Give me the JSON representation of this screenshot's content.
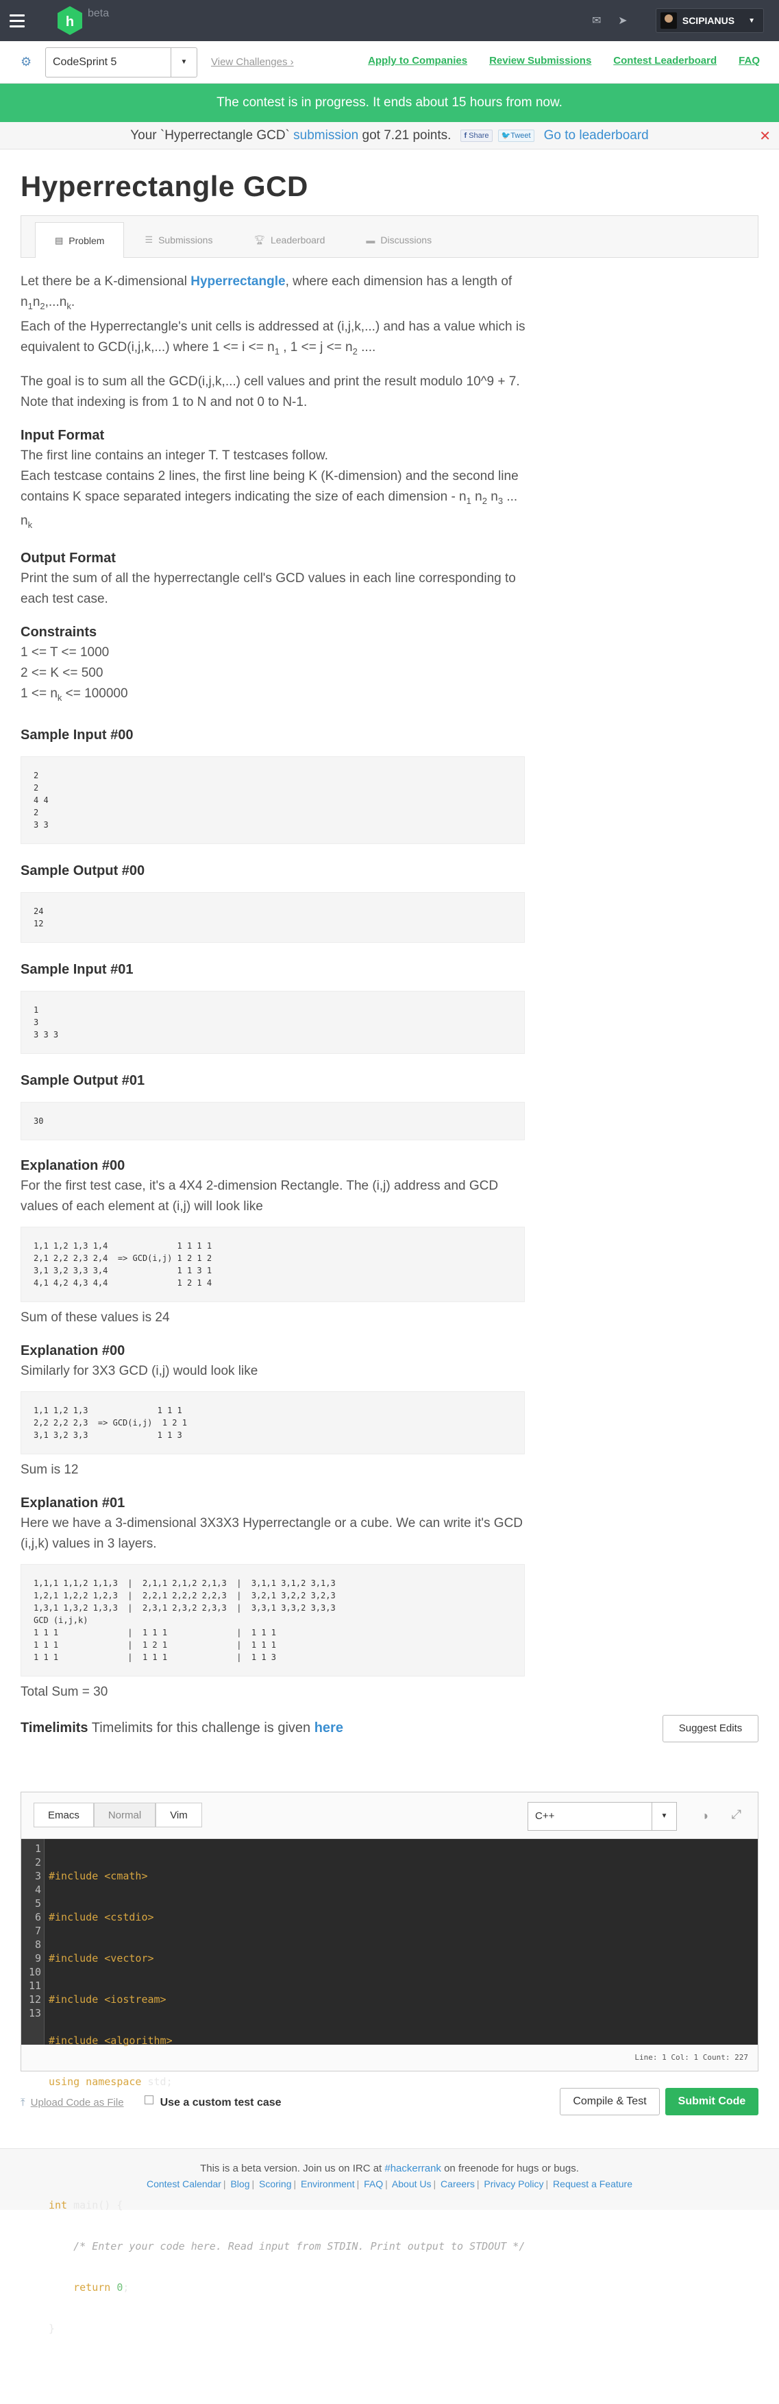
{
  "topnav": {
    "beta": "beta",
    "username": "SCIPIANUS"
  },
  "subnav": {
    "contest": "CodeSprint 5",
    "view_challenges": "View Challenges",
    "links": [
      "Apply to Companies",
      "Review Submissions",
      "Contest Leaderboard",
      "FAQ"
    ]
  },
  "banner": {
    "contest_status": "The contest is in progress. It ends about 15 hours from now.",
    "score_prefix": "Your `Hyperrectangle GCD`",
    "score_link": "submission",
    "score_suffix": "got 7.21 points.",
    "share": "Share",
    "tweet": "Tweet",
    "leaderboard_link": "Go to leaderboard",
    "close": "✕"
  },
  "problem_title": "Hyperrectangle GCD",
  "tabs": [
    "Problem",
    "Submissions",
    "Leaderboard",
    "Discussions"
  ],
  "statement": {
    "p1_a": "Let there be a K-dimensional ",
    "p1_link": "Hyperrectangle",
    "p1_b": ", where each dimension has a length of n",
    "p1_c": "Each of the Hyperrectangle's unit cells is addressed at (i,j,k,...) and has a value which is equivalent to GCD(i,j,k,...) where 1 <= i <= n",
    "p1_d": " , 1 <= j <= n",
    "p1_e": " ....",
    "p2": "The goal is to sum all the GCD(i,j,k,...) cell values and print the result modulo 10^9 + 7. Note that indexing is from 1 to N and not 0 to N-1.",
    "input_title": "Input Format",
    "input_1": "The first line contains an integer T. T testcases follow.",
    "input_2": "Each testcase contains 2 lines, the first line being K (K-dimension) and the second line contains K space separated integers indicating the size of each dimension - n",
    "output_title": "Output Format",
    "output_1": "Print the sum of all the hyperrectangle cell's GCD values in each line corresponding to each test case.",
    "constraints_title": "Constraints",
    "c1": "1 <= T <= 1000",
    "c2": "2 <= K <= 500",
    "c3_a": "1 <= n",
    "c3_b": " <= 100000"
  },
  "samples": [
    {
      "title": "Sample Input #00",
      "code": "2\n2\n4 4\n2\n3 3"
    },
    {
      "title": "Sample Output #00",
      "code": "24\n12"
    },
    {
      "title": "Sample Input #01",
      "code": "1\n3\n3 3 3"
    },
    {
      "title": "Sample Output #01",
      "code": "30"
    }
  ],
  "explanations": [
    {
      "title": "Explanation #00",
      "text": "For the first test case, it's a 4X4 2-dimension Rectangle. The (i,j) address and GCD values of each element at (i,j) will look like",
      "code": "1,1 1,2 1,3 1,4              1 1 1 1\n2,1 2,2 2,3 2,4  => GCD(i,j) 1 2 1 2\n3,1 3,2 3,3 3,4              1 1 3 1\n4,1 4,2 4,3 4,4              1 2 1 4",
      "after": "Sum of these values is 24"
    },
    {
      "title": "Explanation #00",
      "text": "Similarly for 3X3 GCD (i,j) would look like",
      "code": "1,1 1,2 1,3              1 1 1\n2,2 2,2 2,3  => GCD(i,j)  1 2 1\n3,1 3,2 3,3              1 1 3",
      "after": "Sum is 12"
    },
    {
      "title": "Explanation #01",
      "text": "Here we have a 3-dimensional 3X3X3 Hyperrectangle or a cube. We can write it's GCD (i,j,k) values in 3 layers.",
      "code": "1,1,1 1,1,2 1,1,3  |  2,1,1 2,1,2 2,1,3  |  3,1,1 3,1,2 3,1,3\n1,2,1 1,2,2 1,2,3  |  2,2,1 2,2,2 2,2,3  |  3,2,1 3,2,2 3,2,3\n1,3,1 1,3,2 1,3,3  |  2,3,1 2,3,2 2,3,3  |  3,3,1 3,3,2 3,3,3\nGCD (i,j,k)\n1 1 1              |  1 1 1              |  1 1 1\n1 1 1              |  1 2 1              |  1 1 1\n1 1 1              |  1 1 1              |  1 1 3",
      "after": "Total Sum = 30"
    }
  ],
  "timelimits": {
    "label": "Timelimits",
    "text": " Timelimits for this challenge is given ",
    "link": "here",
    "suggest": "Suggest Edits"
  },
  "editor": {
    "keymaps": [
      "Emacs",
      "Normal",
      "Vim"
    ],
    "language": "C++",
    "line_numbers": [
      "1",
      "2",
      "3",
      "4",
      "5",
      "6",
      "7",
      "8",
      "9",
      "10",
      "11",
      "12",
      "13"
    ],
    "includes": [
      "#include <cmath>",
      "#include <cstdio>",
      "#include <vector>",
      "#include <iostream>",
      "#include <algorithm>"
    ],
    "using_kw": "using namespace",
    "using_rest": " std;",
    "main_kw": "int",
    "main_rest": " main() {",
    "comment": "    /* Enter your code here. Read input from STDIN. Print output to STDOUT */",
    "return_kw": "    return ",
    "return_val": "0",
    "return_end": ";",
    "close_brace": "}",
    "status": "Line: 1 Col: 1 Count: 227"
  },
  "actions": {
    "upload": "Upload Code as File",
    "custom": "Use a custom test case",
    "compile": "Compile & Test",
    "submit": "Submit Code"
  },
  "footer": {
    "line_a": "This is a beta version. Join us on IRC at ",
    "irc": "#hackerrank",
    "line_b": " on freenode for hugs or bugs.",
    "links": [
      "Contest Calendar",
      "Blog",
      "Scoring",
      "Environment",
      "FAQ",
      "About Us",
      "Careers",
      "Privacy Policy",
      "Request a Feature"
    ]
  }
}
